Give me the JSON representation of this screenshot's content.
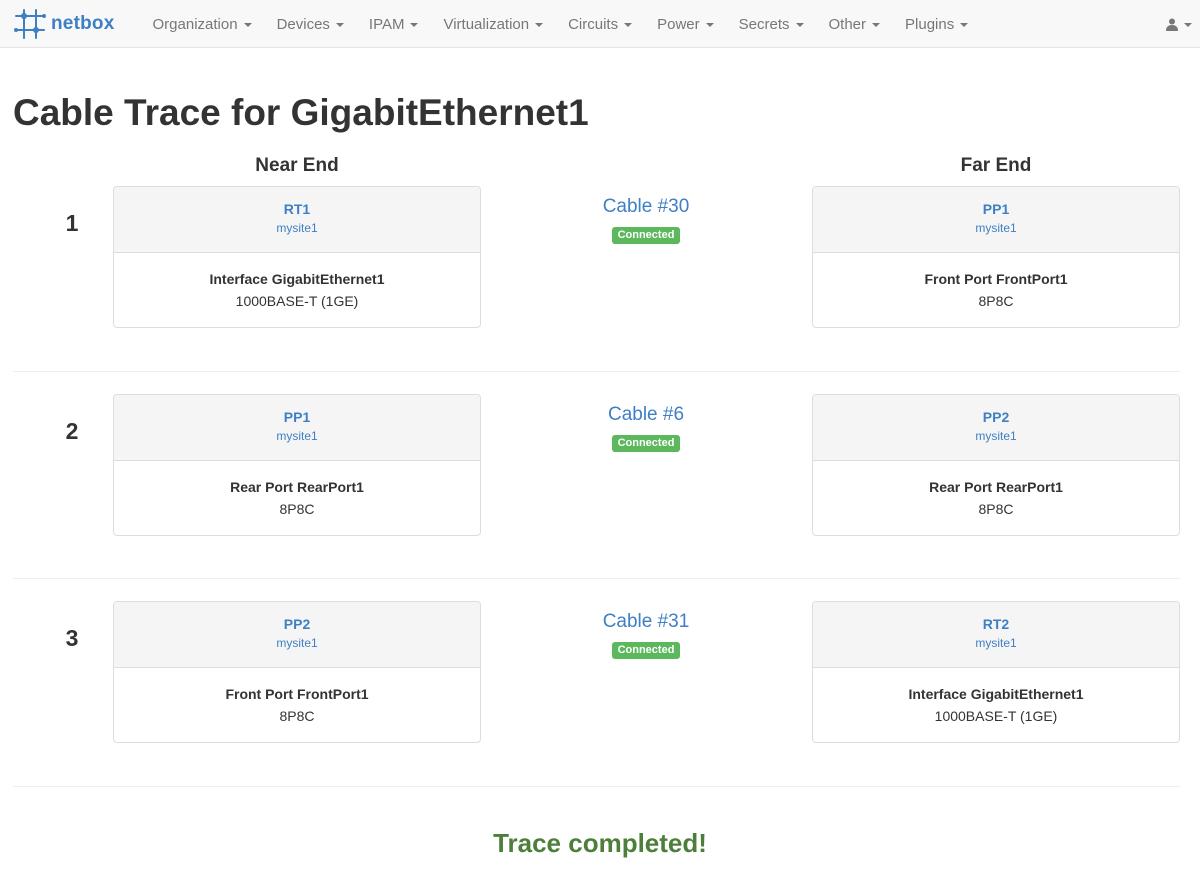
{
  "navbar": {
    "brand": "netbox",
    "items": [
      {
        "label": "Organization"
      },
      {
        "label": "Devices"
      },
      {
        "label": "IPAM"
      },
      {
        "label": "Virtualization"
      },
      {
        "label": "Circuits"
      },
      {
        "label": "Power"
      },
      {
        "label": "Secrets"
      },
      {
        "label": "Other"
      },
      {
        "label": "Plugins"
      }
    ]
  },
  "page": {
    "title": "Cable Trace for GigabitEthernet1",
    "near_end_label": "Near End",
    "far_end_label": "Far End"
  },
  "hops": [
    {
      "number": "1",
      "near": {
        "device": "RT1",
        "site": "mysite1",
        "port": "Interface GigabitEthernet1",
        "type": "1000BASE-T (1GE)"
      },
      "cable": {
        "label": "Cable #30",
        "status": "Connected"
      },
      "far": {
        "device": "PP1",
        "site": "mysite1",
        "port": "Front Port FrontPort1",
        "type": "8P8C"
      }
    },
    {
      "number": "2",
      "near": {
        "device": "PP1",
        "site": "mysite1",
        "port": "Rear Port RearPort1",
        "type": "8P8C"
      },
      "cable": {
        "label": "Cable #6",
        "status": "Connected"
      },
      "far": {
        "device": "PP2",
        "site": "mysite1",
        "port": "Rear Port RearPort1",
        "type": "8P8C"
      }
    },
    {
      "number": "3",
      "near": {
        "device": "PP2",
        "site": "mysite1",
        "port": "Front Port FrontPort1",
        "type": "8P8C"
      },
      "cable": {
        "label": "Cable #31",
        "status": "Connected"
      },
      "far": {
        "device": "RT2",
        "site": "mysite1",
        "port": "Interface GigabitEthernet1",
        "type": "1000BASE-T (1GE)"
      }
    }
  ],
  "trace_status": "Trace completed!",
  "icons": {
    "brand": "netbox-logo-icon",
    "user": "user-icon"
  },
  "colors": {
    "link": "#3f7fc4",
    "connected_badge": "#5cb85c",
    "trace_done": "#4e7f3a"
  }
}
